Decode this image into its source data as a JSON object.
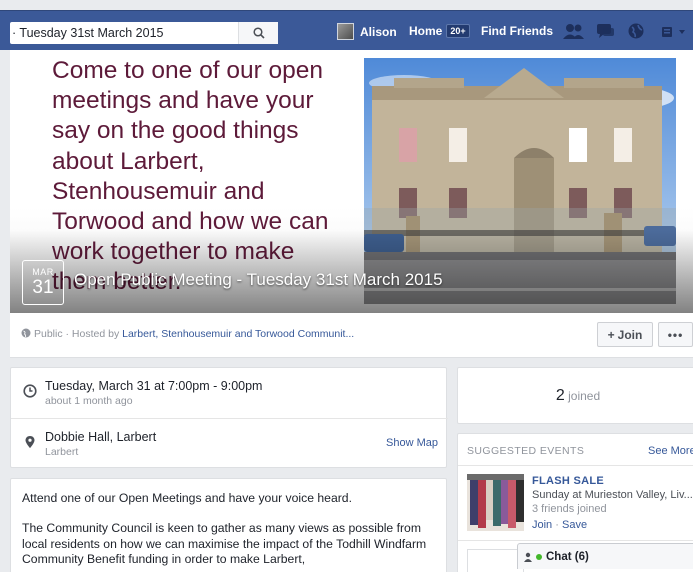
{
  "colors": {
    "brand": "#3b5998",
    "link": "#365899",
    "cover_text": "#5d1a39",
    "online": "#42b72a"
  },
  "topbar": {
    "search_value": "· Tuesday 31st March 2015",
    "search_icon": "search-icon",
    "user_name": "Alison",
    "home_label": "Home",
    "home_badge": "20+",
    "find_friends_label": "Find Friends",
    "icons": [
      "friend-requests-icon",
      "messages-icon",
      "notifications-globe-icon",
      "account-menu-icon"
    ]
  },
  "cover": {
    "text": "Come to one of our open meetings and have your say on the good things about Larbert, Stenhousemuir and Torwood and how we can work together to make them better.",
    "date_month": "MAR",
    "date_day": "31",
    "event_title": "Open Public Meeting - Tuesday 31st March 2015"
  },
  "meta": {
    "privacy": "Public · Hosted by ",
    "host": "Larbert, Stenhousemuir and Torwood Communit...",
    "join_label": "Join",
    "more_label": "•••"
  },
  "details": {
    "time_main": "Tuesday, March 31 at 7:00pm - 9:00pm",
    "time_sub": "about 1 month ago",
    "place_main": "Dobbie Hall, Larbert",
    "place_sub": "Larbert",
    "show_map": "Show Map"
  },
  "description": {
    "p1": "Attend one of our Open Meetings and have your voice heard.",
    "p2": "The Community Council is keen to gather as many views as possible from local residents on how we can maximise the impact of the Todhill Windfarm Community Benefit funding in order to make Larbert,"
  },
  "joined": {
    "count": "2",
    "label": "joined"
  },
  "suggested": {
    "header": "SUGGESTED EVENTS",
    "see_more": "See More",
    "event_title": "FLASH SALE",
    "event_when": "Sunday at Murieston Valley, Liv...",
    "event_friends": "3 friends joined",
    "join": "Join",
    "save": "Save"
  },
  "chat": {
    "label": "Chat (6)"
  }
}
